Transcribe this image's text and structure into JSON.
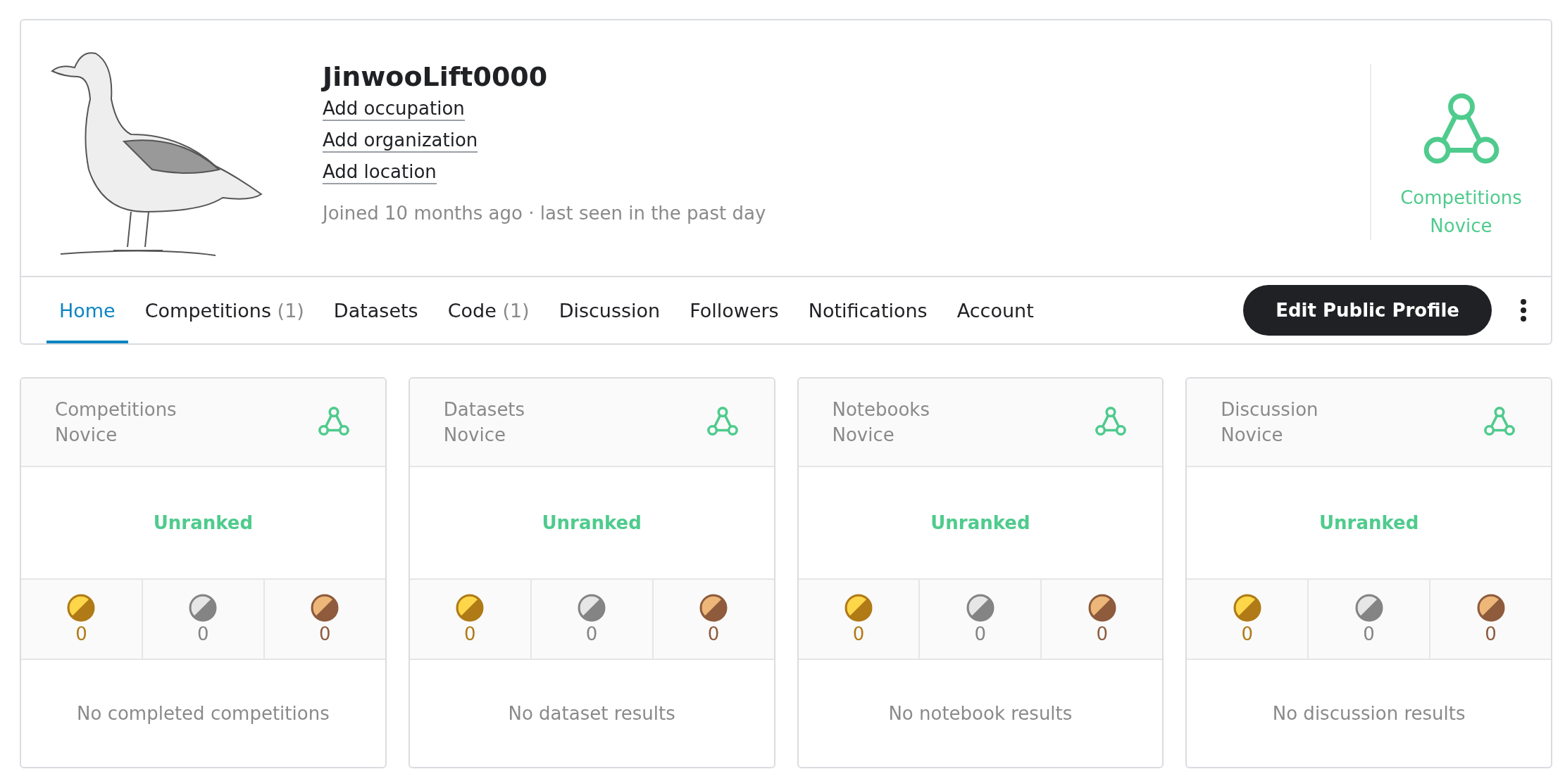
{
  "profile": {
    "username": "JinwooLift0000",
    "links": [
      "Add occupation",
      "Add organization",
      "Add location"
    ],
    "joined": "Joined 10 months ago · last seen in the past day",
    "tier": {
      "label": "Competitions Novice"
    }
  },
  "tabs": [
    {
      "label": "Home",
      "selected": true
    },
    {
      "label": "Competitions",
      "count": "(1)",
      "selected": false
    },
    {
      "label": "Datasets",
      "selected": false
    },
    {
      "label": "Code",
      "count": "(1)",
      "selected": false
    },
    {
      "label": "Discussion",
      "selected": false
    },
    {
      "label": "Followers",
      "selected": false
    },
    {
      "label": "Notifications",
      "selected": false
    },
    {
      "label": "Account",
      "selected": false
    }
  ],
  "edit_button": "Edit Public Profile",
  "cards": [
    {
      "title": "Competitions Novice",
      "rank": "Unranked",
      "medals": [
        {
          "kind": "gold",
          "count": "0"
        },
        {
          "kind": "silver",
          "count": "0"
        },
        {
          "kind": "bronze",
          "count": "0"
        }
      ],
      "footer": "No completed competitions"
    },
    {
      "title": "Datasets Novice",
      "rank": "Unranked",
      "medals": [
        {
          "kind": "gold",
          "count": "0"
        },
        {
          "kind": "silver",
          "count": "0"
        },
        {
          "kind": "bronze",
          "count": "0"
        }
      ],
      "footer": "No dataset results"
    },
    {
      "title": "Notebooks Novice",
      "rank": "Unranked",
      "medals": [
        {
          "kind": "gold",
          "count": "0"
        },
        {
          "kind": "silver",
          "count": "0"
        },
        {
          "kind": "bronze",
          "count": "0"
        }
      ],
      "footer": "No notebook results"
    },
    {
      "title": "Discussion Novice",
      "rank": "Unranked",
      "medals": [
        {
          "kind": "gold",
          "count": "0"
        },
        {
          "kind": "silver",
          "count": "0"
        },
        {
          "kind": "bronze",
          "count": "0"
        }
      ],
      "footer": "No discussion results"
    }
  ]
}
